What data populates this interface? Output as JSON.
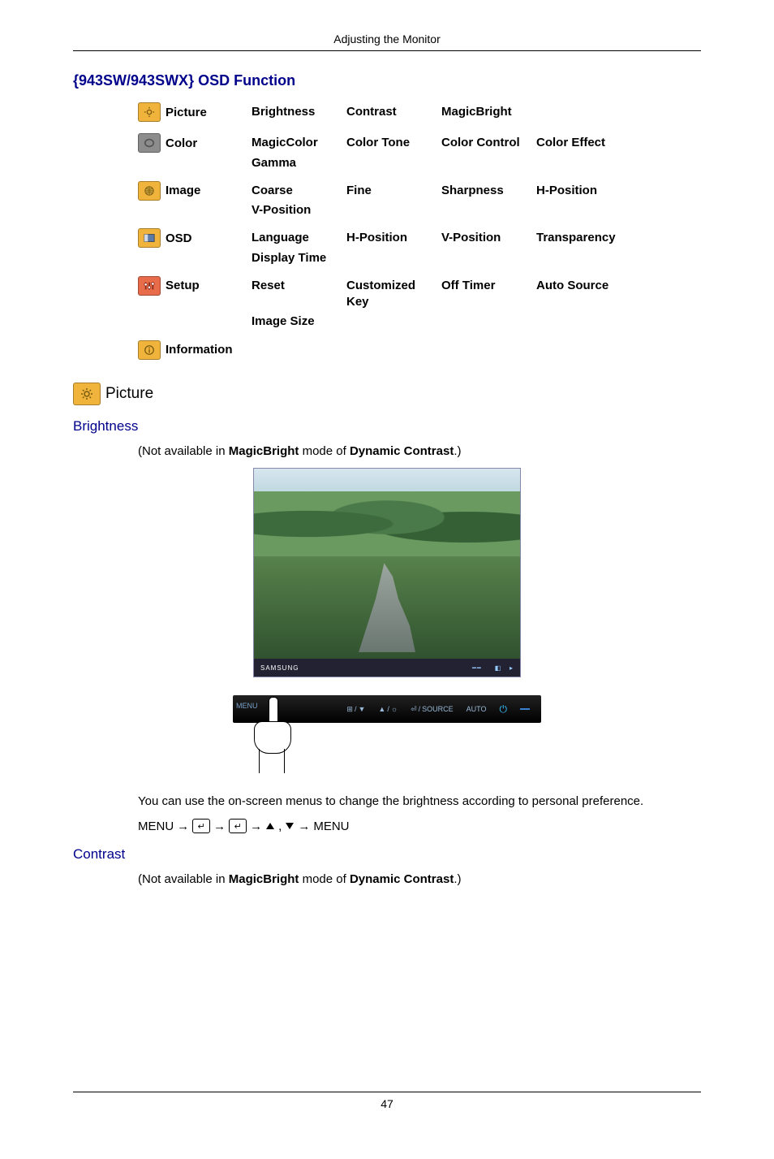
{
  "header": "Adjusting the Monitor",
  "page_number": "47",
  "osd_title": "{943SW/943SWX} OSD Function",
  "osd": [
    {
      "cat": "Picture",
      "icon_bg": "#f0b43c",
      "icon_glyph": "sun",
      "items": [
        "Brightness",
        "Contrast",
        "MagicBright",
        "",
        ""
      ]
    },
    {
      "cat": "Color",
      "icon_bg": "#8c8c8c",
      "icon_glyph": "ring",
      "items": [
        "MagicColor",
        "Color Tone",
        "Color Con­trol",
        "Color Effect",
        "Gamma"
      ]
    },
    {
      "cat": "Image",
      "icon_bg": "#f0b43c",
      "icon_glyph": "globe",
      "items": [
        "Coarse",
        "Fine",
        "Sharpness",
        "H-Position",
        "V-Position"
      ]
    },
    {
      "cat": "OSD",
      "icon_bg": "#f0b43c",
      "icon_glyph": "rect",
      "items": [
        "Language",
        "H-Position",
        "V-Position",
        "Transparen­cy",
        "Display Time"
      ]
    },
    {
      "cat": "Setup",
      "icon_bg": "#e86b4a",
      "icon_glyph": "sliders",
      "items": [
        "Reset",
        "Customized Key",
        "Off Timer",
        "Auto Source",
        "Image Size"
      ]
    },
    {
      "cat": "Information",
      "icon_bg": "#f0b43c",
      "icon_glyph": "info",
      "items": []
    }
  ],
  "picture_heading": "Picture",
  "brightness": {
    "title": "Brightness",
    "note_pre": "(Not available in ",
    "note_b1": "MagicBright",
    "note_mid": "  mode of ",
    "note_b2": "Dynamic Contrast",
    "note_post": ".)",
    "photo_brand": "SAMSUNG",
    "desc": "You can use the on-screen menus to change the brightness according to personal prefer­ence.",
    "seq_menu": "MENU"
  },
  "contrast": {
    "title": "Contrast",
    "note_pre": "(Not available in ",
    "note_b1": "MagicBright",
    "note_mid": " mode of ",
    "note_b2": "Dynamic Contrast",
    "note_post": ".)"
  },
  "buttons_labels": {
    "menu": "MENU",
    "b1_a": "⊞",
    "b1_b": "▼",
    "b2_a": "▲",
    "b2_b": "☼",
    "b3_a": "⏎",
    "b3_b": "SOURCE",
    "auto": "AUTO"
  }
}
